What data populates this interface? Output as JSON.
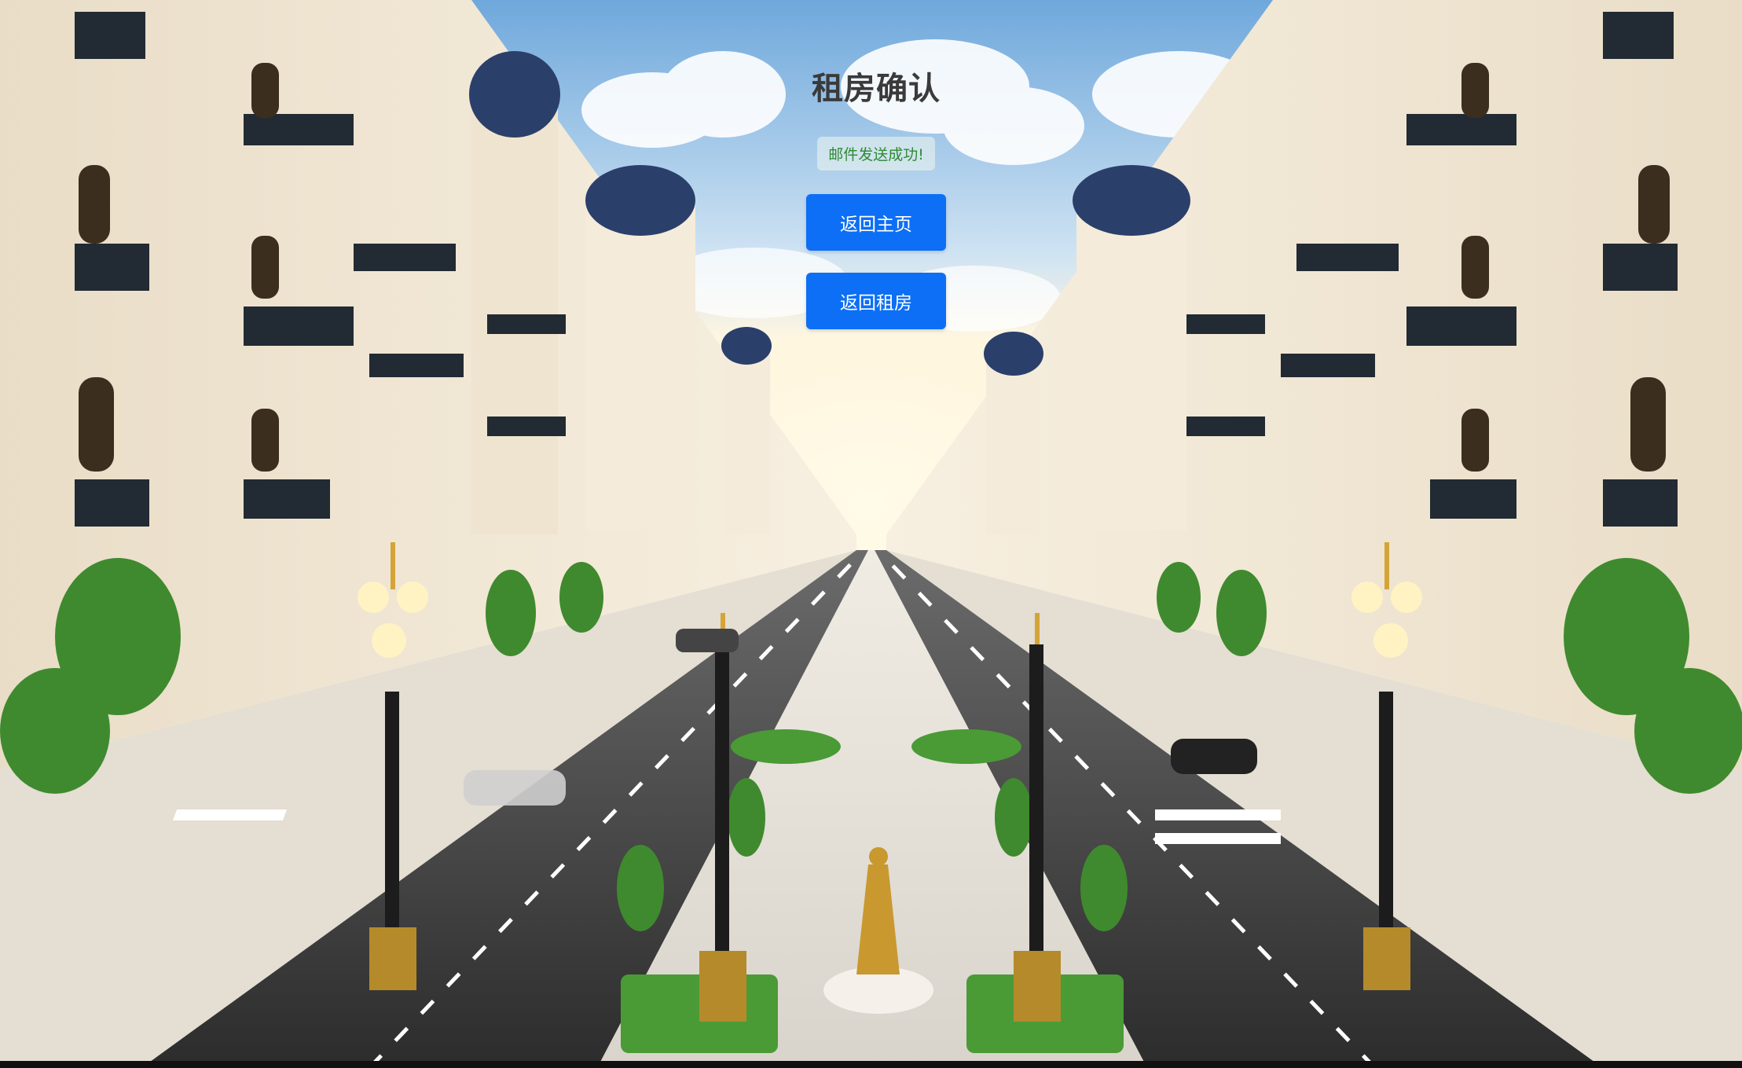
{
  "page": {
    "title": "租房确认",
    "status_message": "邮件发送成功!",
    "buttons": {
      "home": "返回主页",
      "rentals": "返回租房"
    }
  },
  "colors": {
    "button": "#0c6ff5",
    "status_text": "#2d8a34",
    "title_text": "#3a3a3a"
  }
}
